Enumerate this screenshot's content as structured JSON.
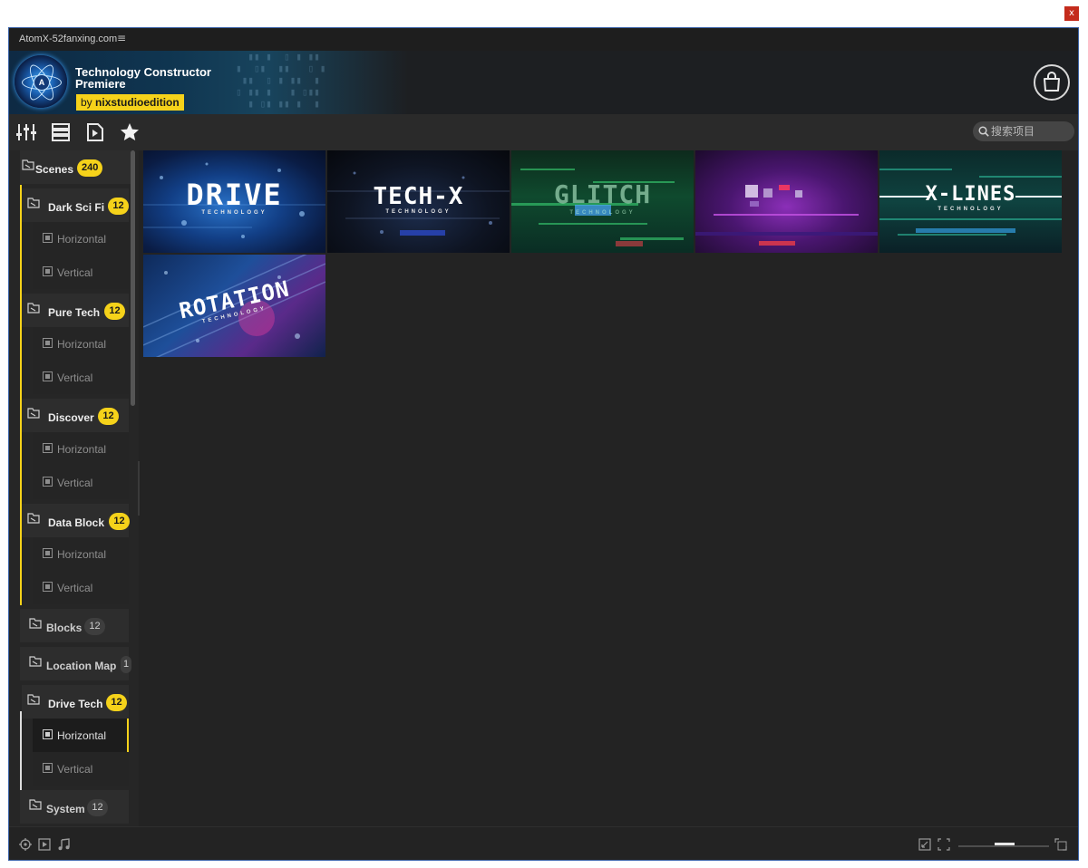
{
  "window": {
    "close_label": "x"
  },
  "panel": {
    "tab_label": "AtomX-52fanxing.com",
    "menu_icon": "hamburger-icon"
  },
  "header": {
    "title_line1": "Technology Constructor",
    "title_line2": "Premiere",
    "by_prefix": "by",
    "by_author": "nixstudioedition",
    "logo_letter": "A"
  },
  "toolbar": {
    "icons": [
      "sliders-icon",
      "list-icon",
      "video-file-icon",
      "star-icon"
    ],
    "search_placeholder": "搜索项目"
  },
  "sidebar": {
    "scenes": {
      "label": "Scenes",
      "count": "240"
    },
    "groups": [
      {
        "label": "Dark Sci Fi",
        "count": "12",
        "children": [
          "Horizontal",
          "Vertical"
        ]
      },
      {
        "label": "Pure Tech",
        "count": "12",
        "children": [
          "Horizontal",
          "Vertical"
        ]
      },
      {
        "label": "Discover",
        "count": "12",
        "children": [
          "Horizontal",
          "Vertical"
        ]
      },
      {
        "label": "Data Block",
        "count": "12",
        "children": [
          "Horizontal",
          "Vertical"
        ]
      }
    ],
    "blocks": {
      "label": "Blocks",
      "count": "12"
    },
    "location_map": {
      "label": "Location Map",
      "count": "1"
    },
    "drive_tech": {
      "label": "Drive Tech",
      "count": "12",
      "children": [
        "Horizontal",
        "Vertical"
      ],
      "active_child": "Horizontal"
    },
    "system": {
      "label": "System",
      "count": "12"
    }
  },
  "thumbnails": [
    {
      "title": "DRIVE",
      "subtitle": "TECHNOLOGY"
    },
    {
      "title": "TECH-X",
      "subtitle": "TECHNOLOGY"
    },
    {
      "title": "GLITCH",
      "subtitle": "TECHNOLOGY"
    },
    {
      "title": "",
      "subtitle": ""
    },
    {
      "title": "X-LINES",
      "subtitle": "TECHNOLOGY"
    },
    {
      "title": "ROTATION",
      "subtitle": "TECHNOLOGY"
    }
  ],
  "statusbar": {
    "left_icons": [
      "target-icon",
      "play-icon",
      "music-note-icon"
    ],
    "right_icons": [
      "shrink-icon",
      "fit-icon",
      "expand-icon"
    ]
  },
  "colors": {
    "accent": "#f5d21a",
    "panel_bg": "#232323",
    "frame_border": "#3b63a8"
  }
}
